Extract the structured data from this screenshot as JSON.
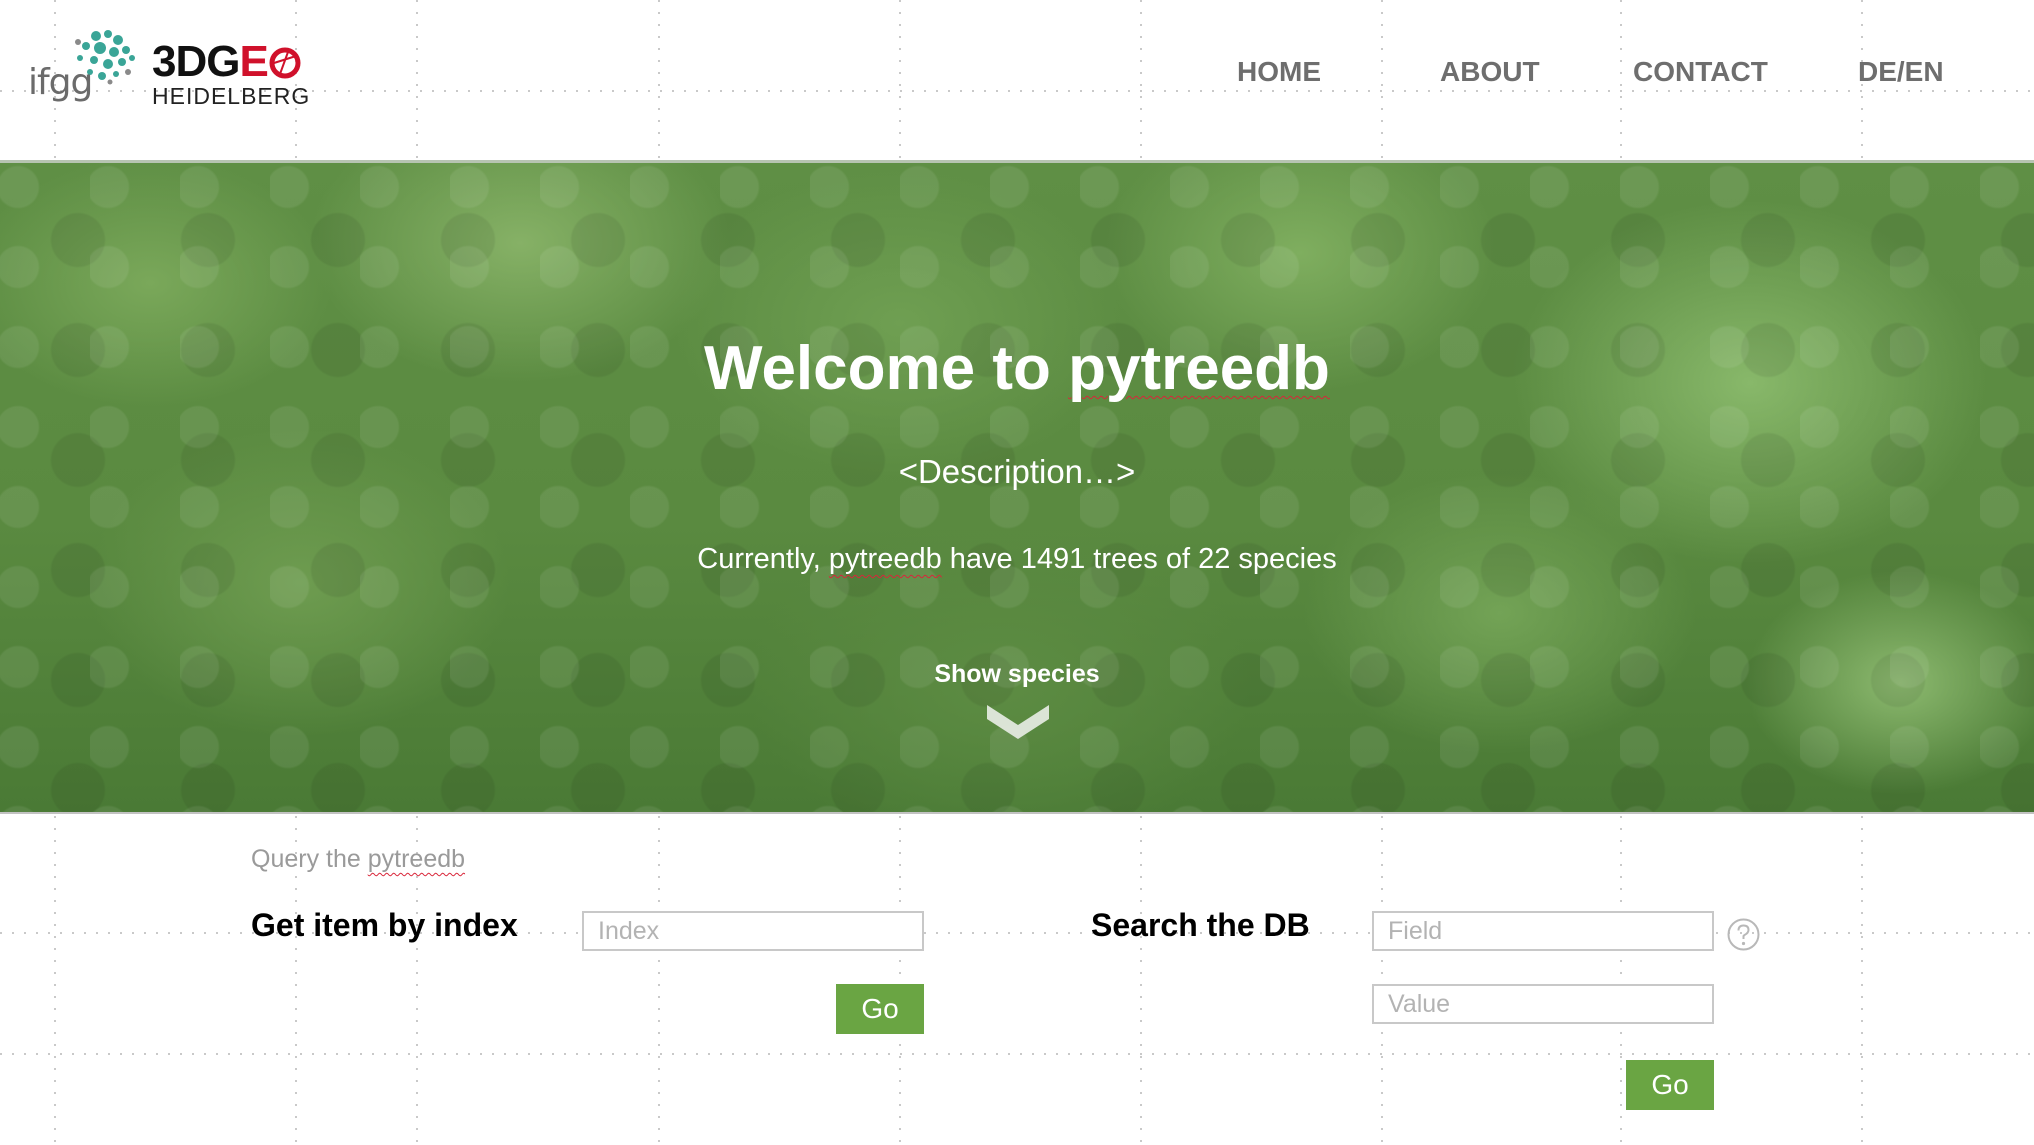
{
  "header": {
    "logo_ifgg": "ifgg",
    "logo_3dgeo_line1_a": "3DG",
    "logo_3dgeo_line1_b": "E",
    "logo_3dgeo_line2": "HEIDELBERG",
    "nav": [
      {
        "label": "HOME"
      },
      {
        "label": "ABOUT"
      },
      {
        "label": "CONTACT"
      },
      {
        "label": "DE/EN"
      }
    ]
  },
  "hero": {
    "title_prefix": "Welcome to ",
    "title_name": "pytreedb",
    "description": "<Description…>",
    "stats_prefix": "Currently, ",
    "stats_name": "pytreedb",
    "stats_suffix": " have 1491 trees of 22 species",
    "show_species_label": "Show species",
    "icons": {
      "chevron": "chevron-down-icon"
    }
  },
  "query": {
    "caption_prefix": "Query the ",
    "caption_name": "pytreedb",
    "get_item": {
      "label": "Get item by index",
      "index_placeholder": "Index",
      "go_label": "Go"
    },
    "search": {
      "label": "Search the DB",
      "field_placeholder": "Field",
      "value_placeholder": "Value",
      "go_label": "Go",
      "icons": {
        "help": "help-icon"
      }
    }
  },
  "colors": {
    "accent_green": "#6aa543",
    "logo_red": "#d0112b",
    "nav_grey": "#6e6e6e"
  }
}
